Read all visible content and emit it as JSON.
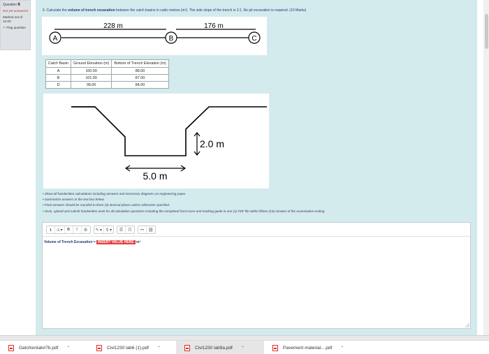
{
  "question_info": {
    "label": "Question",
    "number": "6",
    "state": "Not yet answered",
    "marks": "Marked out of 10.00",
    "flag": "Flag question"
  },
  "question": {
    "prefix": "6. Calculate the ",
    "bold": "volume of trench excavation",
    "suffix": " between the catch basins in cubic metres (m³). The side slope of the trench is 2:1. No pit excavation is required. (10 Marks)"
  },
  "layout_diagram": {
    "nodes": [
      "A",
      "B",
      "C"
    ],
    "distances": [
      "228 m",
      "176 m"
    ]
  },
  "table": {
    "headers": [
      "Catch Basin",
      "Ground Elevation (m)",
      "Bottom of Trench Elevation (m)"
    ],
    "rows": [
      [
        "A",
        "100.00",
        "88.00"
      ],
      [
        "B",
        "101.00",
        "87.00"
      ],
      [
        "D",
        "99.00",
        "84.00"
      ]
    ]
  },
  "trench_diagram": {
    "depth_label": "2.0 m",
    "width_label": "5.0 m"
  },
  "instructions": [
    "Show all handwritten calculations including answers and necessary diagrams on engineering paper.",
    "Summarize answers in the text box below.",
    "Final answers should be rounded to three (3) decimal places unless otherwise specified.",
    "Scan, upload and submit handwritten work for all calculation questions including the completed front cover and marking guide in one (1) PDF file within fifteen (15) minutes of the examination ending."
  ],
  "editor": {
    "toolbar": [
      "ℹ",
      "A ▾",
      "B",
      "I",
      "⚙",
      "✎ ▾",
      "⚲ ▾",
      "☰",
      "☷",
      "⚯",
      "⛓"
    ],
    "answer_label": "Volume of Trench Excavation = ",
    "answer_value": "INSERT VALUE HERE",
    "answer_unit": " m³"
  },
  "downloads": [
    {
      "name": "Gatchionlab#7b.pdf",
      "active": false
    },
    {
      "name": "Civl1230 lab6 (1).pdf",
      "active": false
    },
    {
      "name": "Civl1230 lab9a.pdf",
      "active": true
    },
    {
      "name": "Pavement material....pdf",
      "active": false
    }
  ]
}
